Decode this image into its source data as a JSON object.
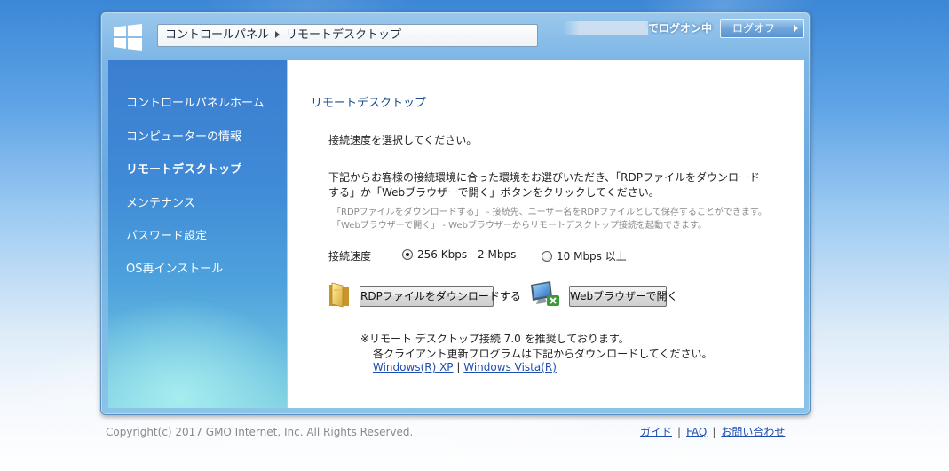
{
  "header": {
    "breadcrumb": [
      "コントロールパネル",
      "リモートデスクトップ"
    ],
    "logon_status": "でログオン中",
    "logoff_label": "ログオフ"
  },
  "sidebar": {
    "items": [
      {
        "label": "コントロールパネルホーム",
        "active": false
      },
      {
        "label": "コンピューターの情報",
        "active": false
      },
      {
        "label": "リモートデスクトップ",
        "active": true
      },
      {
        "label": "メンテナンス",
        "active": false
      },
      {
        "label": "パスワード設定",
        "active": false
      },
      {
        "label": "OS再インストール",
        "active": false
      }
    ]
  },
  "main": {
    "heading": "リモートデスクトップ",
    "instruction": "接続速度を選択してください。",
    "description_line1": "下記からお客様の接続環境に合った環境をお選びいただき、「RDPファイルをダウンロード",
    "description_line2": "する」か「Webブラウザーで開く」ボタンをクリックしてください。",
    "note_line1": "「RDPファイルをダウンロードする」 - 接続先、ユーザー名をRDPファイルとして保存することができます。",
    "note_line2": "「Webブラウザーで開く」 - Webブラウザーからリモートデスクトップ接続を起動できます。",
    "speed_label": "接続速度",
    "speed_options": [
      {
        "label": "256 Kbps - 2 Mbps",
        "selected": true
      },
      {
        "label": "10 Mbps 以上",
        "selected": false
      }
    ],
    "rdp_button": "RDPファイルをダウンロードする",
    "browser_button": "Webブラウザーで開く",
    "recommend_line1": "※リモート デスクトップ接続 7.0 を推奨しております。",
    "recommend_line2": "各クライアント更新プログラムは下記からダウンロードしてください。",
    "link_xp": "Windows(R) XP",
    "link_separator": "|",
    "link_vista": "Windows Vista(R)"
  },
  "footer": {
    "copyright": "Copyright(c) 2017 GMO Internet, Inc. All Rights Reserved.",
    "links": [
      "ガイド",
      "FAQ",
      "お問い合わせ"
    ],
    "separator": "|"
  },
  "colors": {
    "accent": "#1a4c8c",
    "link": "#1f4fb0",
    "sidebar_top": "#3b7ed0",
    "sidebar_bottom": "#7fd0e2"
  },
  "icons": [
    "windows-logo-icon",
    "breadcrumb-arrow-icon",
    "logoff-arrow-icon",
    "folder-icon",
    "remote-desktop-monitor-icon"
  ]
}
